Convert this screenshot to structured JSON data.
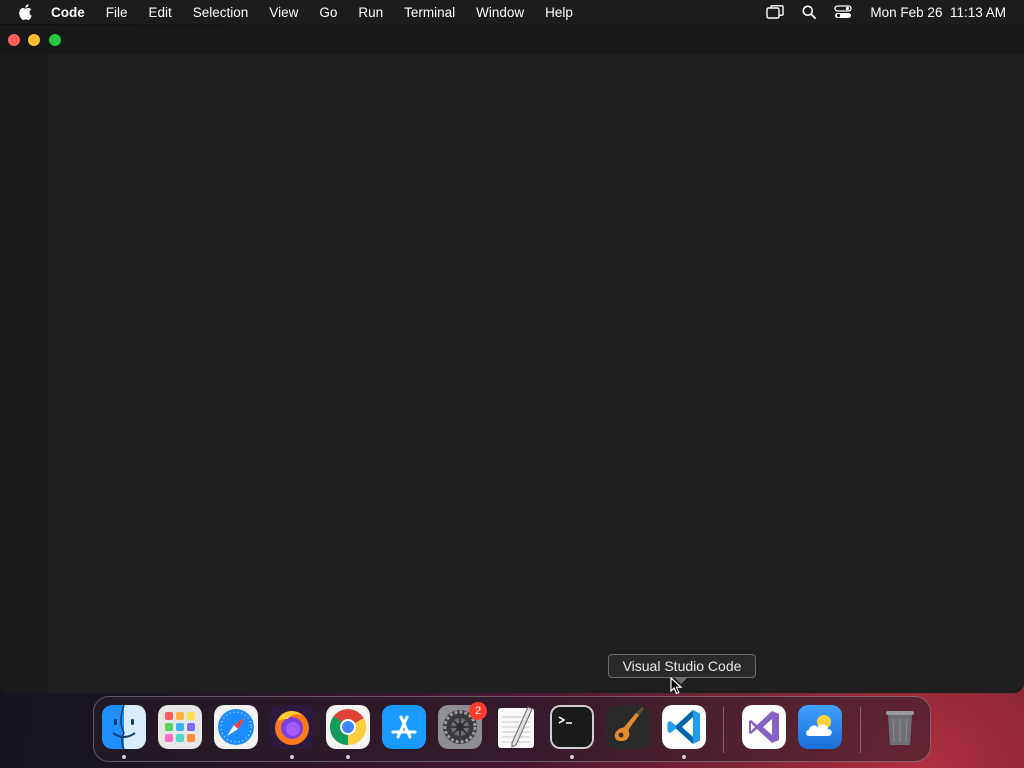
{
  "menubar": {
    "app_name": "Code",
    "items": [
      "File",
      "Edit",
      "Selection",
      "View",
      "Go",
      "Run",
      "Terminal",
      "Window",
      "Help"
    ],
    "clock": "Mon Feb 26  11:13 AM"
  },
  "tooltip": {
    "label": "Visual Studio Code"
  },
  "dock": {
    "apps": [
      {
        "name": "Finder",
        "icon": "finder-icon",
        "running": true
      },
      {
        "name": "Launchpad",
        "icon": "launchpad-icon",
        "running": false
      },
      {
        "name": "Safari",
        "icon": "safari-icon",
        "running": false
      },
      {
        "name": "Firefox",
        "icon": "firefox-icon",
        "running": true
      },
      {
        "name": "Google Chrome",
        "icon": "chrome-icon",
        "running": true
      },
      {
        "name": "App Store",
        "icon": "app-store-icon",
        "running": false
      },
      {
        "name": "System Settings",
        "icon": "system-settings-icon",
        "running": false,
        "badge": "2"
      },
      {
        "name": "TextEdit",
        "icon": "textedit-icon",
        "running": false
      },
      {
        "name": "Terminal",
        "icon": "terminal-icon",
        "running": true
      },
      {
        "name": "GarageBand",
        "icon": "garageband-icon",
        "running": false
      },
      {
        "name": "Visual Studio Code",
        "icon": "vscode-icon",
        "running": true
      },
      {
        "name": "Visual Studio",
        "icon": "visual-studio-icon",
        "running": false
      },
      {
        "name": "Weather",
        "icon": "weather-icon",
        "running": false
      },
      {
        "name": "Trash",
        "icon": "trash-icon",
        "running": false
      }
    ]
  },
  "colors": {
    "close": "#ff5f57",
    "minimize": "#febc2e",
    "maximize": "#28c840",
    "badge": "#ff3b30"
  }
}
